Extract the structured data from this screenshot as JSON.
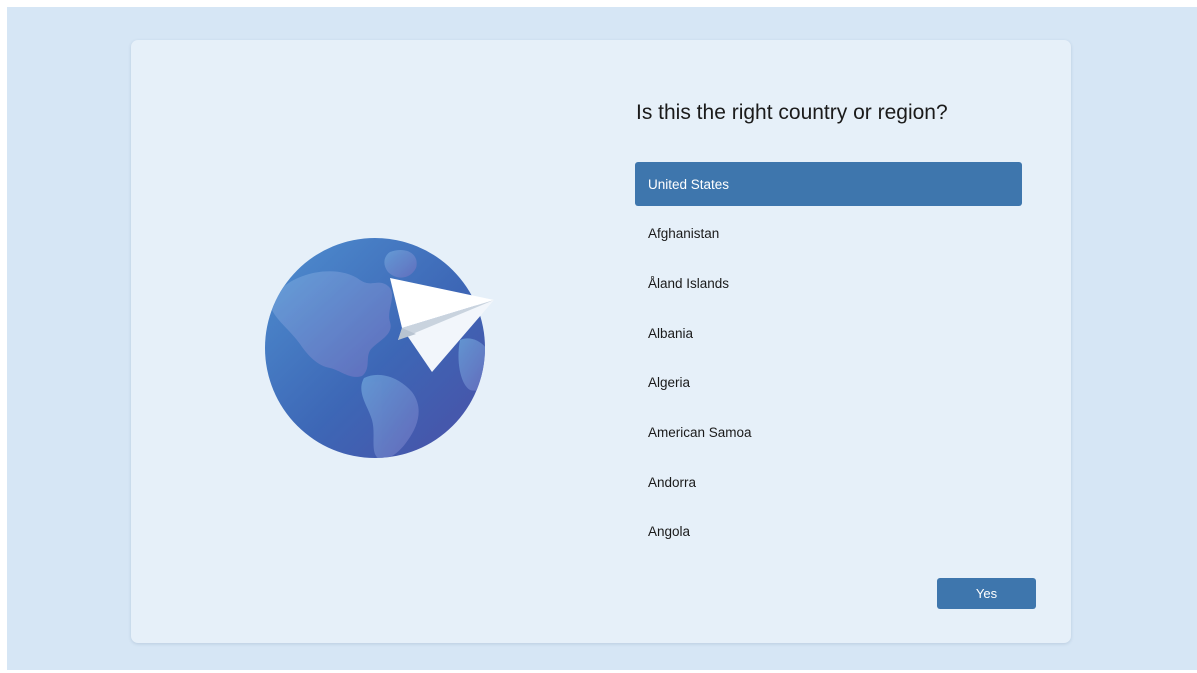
{
  "setup": {
    "title": "Is this the right country or region?",
    "selected_country": "United States",
    "countries": [
      "United States",
      "Afghanistan",
      "Åland Islands",
      "Albania",
      "Algeria",
      "American Samoa",
      "Andorra",
      "Angola"
    ],
    "yes_label": "Yes"
  },
  "colors": {
    "desktop_background": "#d6e6f5",
    "card_background": "#e6f0f9",
    "accent": "#3e76ad",
    "globe_light": "#4c83c8",
    "globe_dark": "#3a5aa8"
  },
  "icons": {
    "illustration": "globe-with-paper-plane-icon"
  }
}
